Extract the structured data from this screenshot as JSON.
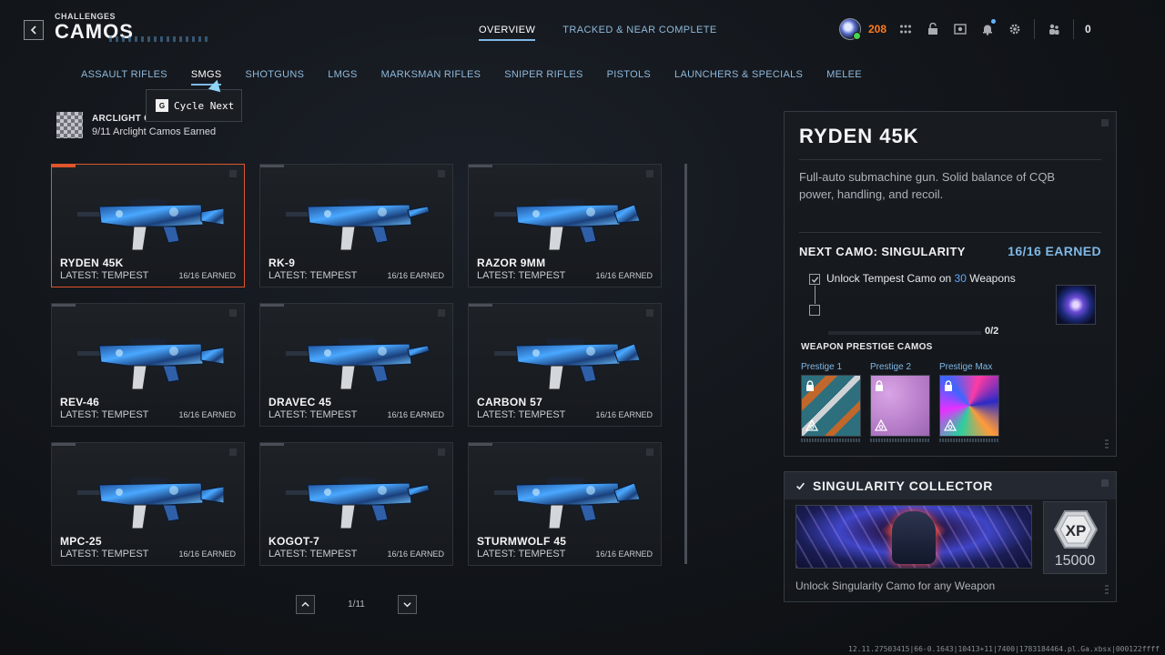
{
  "header": {
    "breadcrumb": "CHALLENGES",
    "title": "CAMOS",
    "tabs": [
      {
        "label": "OVERVIEW",
        "active": true
      },
      {
        "label": "TRACKED & NEAR COMPLETE",
        "active": false
      }
    ],
    "player_level": "208",
    "party_count": "0",
    "icons": [
      "avatar-icon",
      "grid-menu-icon",
      "unlock-icon",
      "social-icon",
      "bell-icon",
      "gear-icon",
      "party-icon"
    ]
  },
  "categories": [
    {
      "label": "ASSAULT RIFLES",
      "active": false
    },
    {
      "label": "SMGS",
      "active": true
    },
    {
      "label": "SHOTGUNS",
      "active": false
    },
    {
      "label": "LMGS",
      "active": false
    },
    {
      "label": "MARKSMAN RIFLES",
      "active": false
    },
    {
      "label": "SNIPER RIFLES",
      "active": false
    },
    {
      "label": "PISTOLS",
      "active": false
    },
    {
      "label": "LAUNCHERS & SPECIALS",
      "active": false
    },
    {
      "label": "MELEE",
      "active": false
    }
  ],
  "tooltip": {
    "key": "G",
    "text": "Cycle Next"
  },
  "arclight": {
    "title": "ARCLIGHT CA",
    "subtitle": "9/11 Arclight Camos Earned"
  },
  "weapons": [
    {
      "name": "RYDEN 45K",
      "latest": "LATEST: TEMPEST",
      "earned": "16/16 EARNED",
      "selected": true
    },
    {
      "name": "RK-9",
      "latest": "LATEST: TEMPEST",
      "earned": "16/16 EARNED",
      "selected": false
    },
    {
      "name": "RAZOR 9MM",
      "latest": "LATEST: TEMPEST",
      "earned": "16/16 EARNED",
      "selected": false
    },
    {
      "name": "REV-46",
      "latest": "LATEST: TEMPEST",
      "earned": "16/16 EARNED",
      "selected": false
    },
    {
      "name": "DRAVEC 45",
      "latest": "LATEST: TEMPEST",
      "earned": "16/16 EARNED",
      "selected": false
    },
    {
      "name": "CARBON 57",
      "latest": "LATEST: TEMPEST",
      "earned": "16/16 EARNED",
      "selected": false
    },
    {
      "name": "MPC-25",
      "latest": "LATEST: TEMPEST",
      "earned": "16/16 EARNED",
      "selected": false
    },
    {
      "name": "KOGOT-7",
      "latest": "LATEST: TEMPEST",
      "earned": "16/16 EARNED",
      "selected": false
    },
    {
      "name": "STURMWOLF 45",
      "latest": "LATEST: TEMPEST",
      "earned": "16/16 EARNED",
      "selected": false
    }
  ],
  "pager": {
    "label": "1/11"
  },
  "detail": {
    "name": "RYDEN 45K",
    "description": "Full-auto submachine gun. Solid balance of CQB power, handling, and recoil.",
    "next_camo": "NEXT CAMO: SINGULARITY",
    "earned": "16/16 EARNED",
    "challenge_prefix": "Unlock Tempest Camo on ",
    "challenge_count": "30",
    "challenge_suffix": " Weapons",
    "progress_text": "0/2",
    "progress_fraction": 0.0,
    "prestige_title": "WEAPON PRESTIGE CAMOS",
    "prestige": [
      {
        "label": "Prestige 1"
      },
      {
        "label": "Prestige 2"
      },
      {
        "label": "Prestige Max"
      }
    ]
  },
  "collector": {
    "title": "SINGULARITY COLLECTOR",
    "xp_label": "XP",
    "xp_value": "15000",
    "description": "Unlock Singularity Camo for any Weapon"
  },
  "build_info": "12.11.27503415|66-0.1643|10413+11|7400|1783184464.pl.Ga.xbsx|000122ffff"
}
